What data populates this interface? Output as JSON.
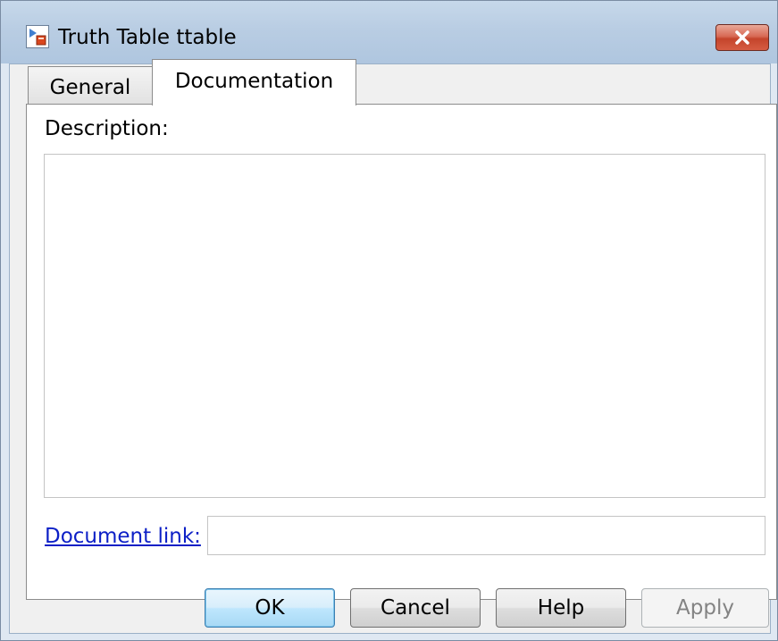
{
  "window": {
    "title": "Truth Table ttable",
    "icon": "stateflow-truth-table-icon",
    "close_icon": "close-icon"
  },
  "tabs": [
    {
      "label": "General",
      "active": false
    },
    {
      "label": "Documentation",
      "active": true
    }
  ],
  "documentation": {
    "description_label": "Description:",
    "description_value": "",
    "document_link_label": "Document link:",
    "document_link_value": ""
  },
  "buttons": {
    "ok": "OK",
    "cancel": "Cancel",
    "help": "Help",
    "apply": "Apply"
  },
  "colors": {
    "link": "#0c1fc6",
    "close_button": "#c4442b",
    "ok_focus": "#3c7fb1"
  }
}
